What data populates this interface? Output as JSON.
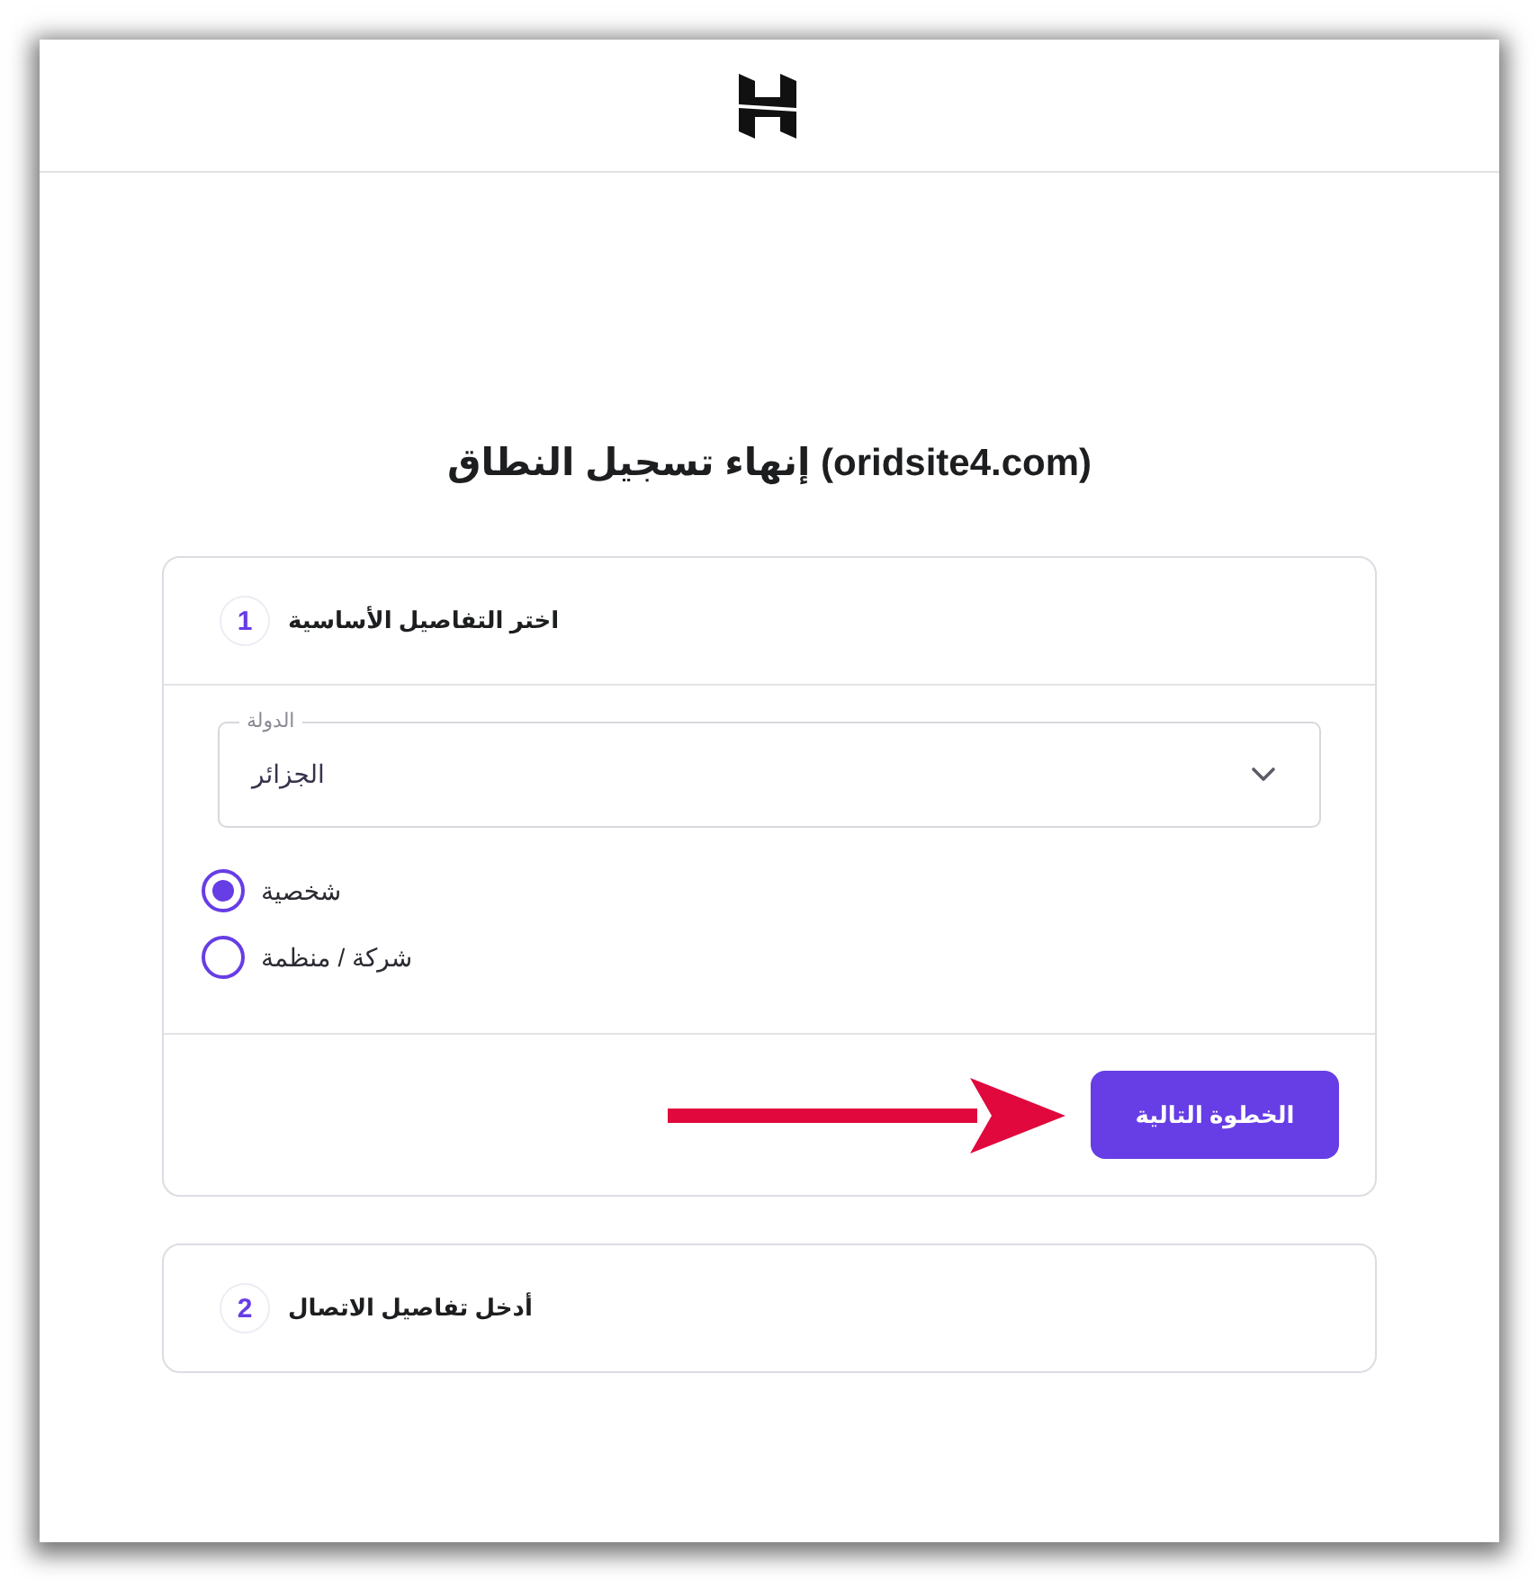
{
  "title": "إنهاء تسجيل النطاق (oridsite4.com)",
  "steps": [
    {
      "number": "1",
      "title": "اختر التفاصيل الأساسية",
      "expanded": true,
      "country_field": {
        "label": "الدولة",
        "value": "الجزائر"
      },
      "account_types": [
        {
          "label": "شخصية",
          "selected": true
        },
        {
          "label": "شركة / منظمة",
          "selected": false
        }
      ],
      "next_button": "الخطوة التالية"
    },
    {
      "number": "2",
      "title": "أدخل تفاصيل الاتصال",
      "expanded": false
    }
  ]
}
